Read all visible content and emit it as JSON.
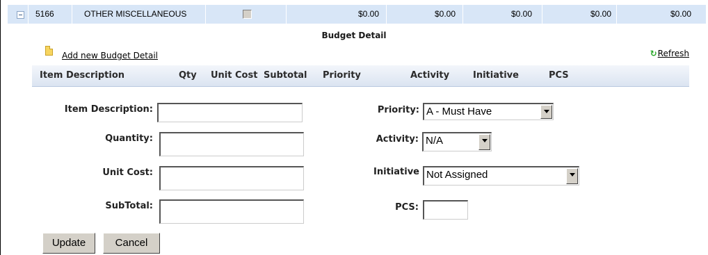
{
  "category_row": {
    "code": "5166",
    "name": "OTHER MISCELLANEOUS",
    "checked": false,
    "amounts": [
      "$0.00",
      "$0.00",
      "$0.00",
      "$0.00",
      "$0.00"
    ]
  },
  "section_title": "Budget Detail",
  "add_link": "Add new Budget Detail",
  "refresh_link": "Refresh",
  "columns": [
    "Item Description",
    "Qty",
    "Unit Cost",
    "Subtotal",
    "Priority",
    "Activity",
    "Initiative",
    "PCS"
  ],
  "form": {
    "item_description": {
      "label": "Item Description:",
      "value": ""
    },
    "quantity": {
      "label": "Quantity:",
      "value": ""
    },
    "unit_cost": {
      "label": "Unit Cost:",
      "value": ""
    },
    "subtotal": {
      "label": "SubTotal:",
      "value": ""
    },
    "priority": {
      "label": "Priority:",
      "selected": "A - Must Have"
    },
    "activity": {
      "label": "Activity:",
      "selected": "N/A"
    },
    "initiative": {
      "label": "Initiative",
      "selected": "Not Assigned"
    },
    "pcs": {
      "label": "PCS:",
      "value": ""
    }
  },
  "buttons": {
    "update": "Update",
    "cancel": "Cancel"
  },
  "icons": {
    "collapse": "minus-box-icon",
    "add": "document-icon",
    "refresh": "refresh-icon",
    "dropdown": "chevron-down-icon"
  }
}
